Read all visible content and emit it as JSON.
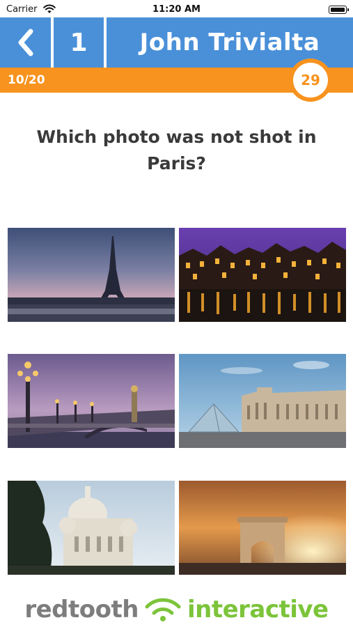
{
  "status_bar": {
    "carrier": "Carrier",
    "time": "11:20 AM"
  },
  "header": {
    "back_icon": "chevron-left-icon",
    "round_number": "1",
    "player_name": "John Trivialta",
    "background_color": "#4a90d9"
  },
  "progress": {
    "label": "10/20",
    "timer": "29",
    "color": "#f7931e"
  },
  "question": {
    "text": "Which photo was not shot in Paris?"
  },
  "answers": [
    {
      "scene": "eiffel-tower-dusk"
    },
    {
      "scene": "amsterdam-canal-night"
    },
    {
      "scene": "pont-alexandre-iii-bridge"
    },
    {
      "scene": "louvre-pyramid"
    },
    {
      "scene": "sacre-coeur-basilica"
    },
    {
      "scene": "arc-de-triomphe-sunset"
    }
  ],
  "footer": {
    "logo_left": "redtooth",
    "logo_right": "interactive"
  }
}
